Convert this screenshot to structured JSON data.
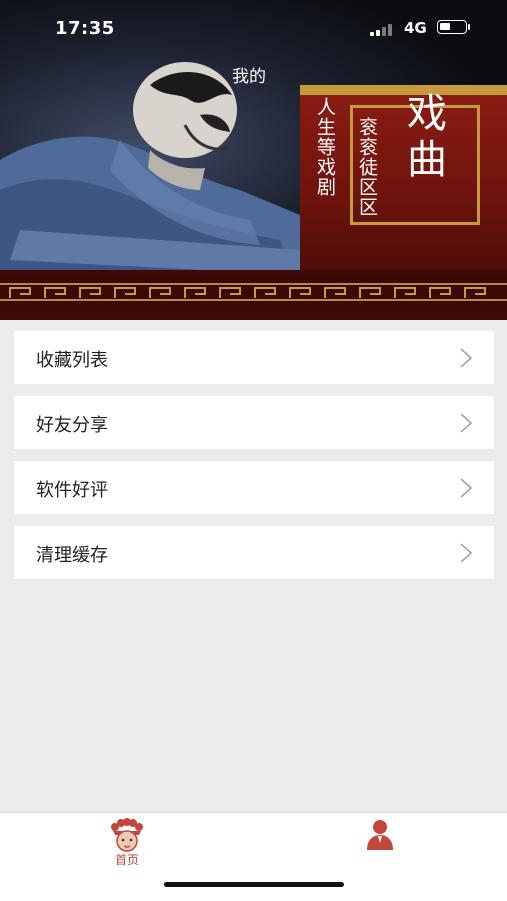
{
  "status_bar": {
    "time": "17:35",
    "network": "4G",
    "battery_level": 0.45
  },
  "hero": {
    "mine": "我的",
    "title": "戏曲",
    "line1": "人生等戏剧",
    "line2": "衮衮徒区区"
  },
  "menu": {
    "items": [
      {
        "label": "收藏列表"
      },
      {
        "label": "好友分享"
      },
      {
        "label": "软件好评"
      },
      {
        "label": "清理缓存"
      }
    ]
  },
  "tabbar": {
    "home_label": "首页",
    "accent": "#c0473a"
  }
}
